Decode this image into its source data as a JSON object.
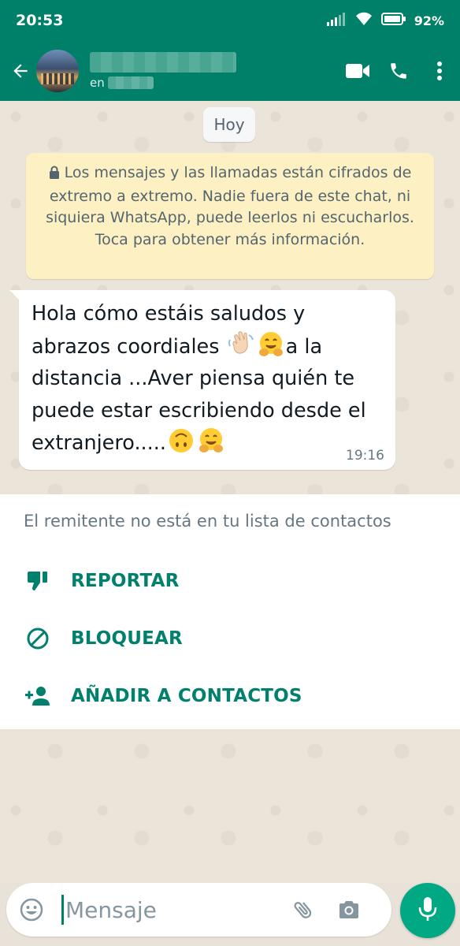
{
  "status_bar": {
    "time": "20:53",
    "battery": "92%"
  },
  "header": {
    "status_text": "en"
  },
  "chat": {
    "date_chip": "Hoy",
    "encryption_notice": "Los mensajes y las llamadas están cifrados de extremo a extremo. Nadie fuera de este chat, ni siquiera WhatsApp, puede leerlos ni escucharlos. Toca para obtener más información.",
    "message": {
      "line1": "Hola cómo estáis saludos y",
      "line2a": "abrazos coordiales ",
      "line2b": "a la",
      "line3": "distancia ...Aver piensa quién te",
      "line4": "puede estar escribiendo desde el",
      "line5": "extranjero.....",
      "time": "19:16"
    }
  },
  "unknown_sender": {
    "notice": "El remitente no está en tu lista de contactos",
    "report_label": "REPORTAR",
    "block_label": "BLOQUEAR",
    "add_contact_label": "AÑADIR A CONTACTOS"
  },
  "input_bar": {
    "placeholder": "Mensaje"
  },
  "icons": {
    "back": "back-arrow-icon",
    "video": "video-call-icon",
    "call": "phone-icon",
    "menu": "more-vert-icon",
    "lock": "lock-icon",
    "report": "thumb-down-icon",
    "block": "block-icon",
    "add_contact": "person-add-icon",
    "emoji": "emoji-icon",
    "attach": "paperclip-icon",
    "camera": "camera-icon",
    "mic": "microphone-icon"
  },
  "colors": {
    "brand": "#008069",
    "accent": "#00a884",
    "action_text": "#00806d",
    "notice_bg": "#fdf0c3"
  }
}
